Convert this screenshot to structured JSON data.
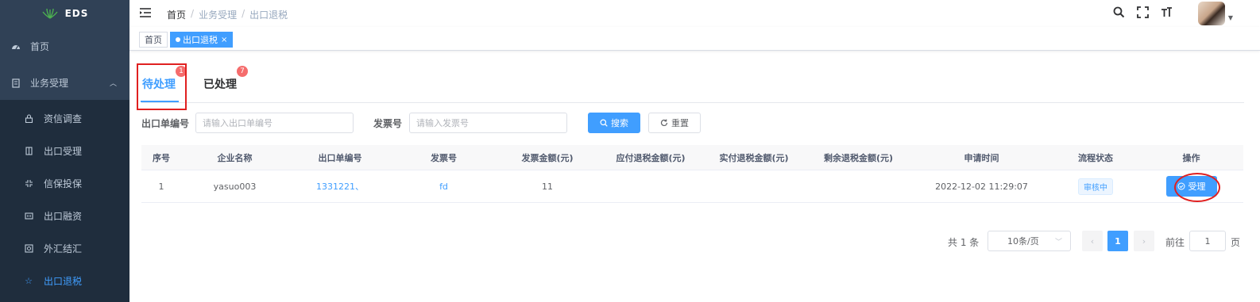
{
  "app": {
    "logo_text": "EDS"
  },
  "sidebar": {
    "items": [
      {
        "label": "首页",
        "icon": "dashboard-icon"
      },
      {
        "label": "业务受理",
        "icon": "business-icon",
        "expanded": true
      },
      {
        "label": "资信调查",
        "icon": "lock-icon"
      },
      {
        "label": "出口受理",
        "icon": "door-icon"
      },
      {
        "label": "信保投保",
        "icon": "shrink-icon"
      },
      {
        "label": "出口融资",
        "icon": "finance-icon"
      },
      {
        "label": "外汇结汇",
        "icon": "exchange-icon"
      },
      {
        "label": "出口退税",
        "icon": "star-icon",
        "active": true
      }
    ]
  },
  "header": {
    "breadcrumb": [
      "首页",
      "业务受理",
      "出口退税"
    ],
    "separator": "/"
  },
  "tags": [
    {
      "label": "首页",
      "active": false
    },
    {
      "label": "出口退税",
      "active": true,
      "close": "×"
    }
  ],
  "tabs": [
    {
      "label": "待处理",
      "badge": "1",
      "active": true
    },
    {
      "label": "已处理",
      "badge": "7",
      "active": false
    }
  ],
  "search": {
    "export_no_label": "出口单编号",
    "export_no_placeholder": "请输入出口单编号",
    "invoice_label": "发票号",
    "invoice_placeholder": "请输入发票号",
    "search_btn": "搜索",
    "reset_btn": "重置"
  },
  "table": {
    "columns": [
      "序号",
      "企业名称",
      "出口单编号",
      "发票号",
      "发票金额(元)",
      "应付退税金额(元)",
      "实付退税金额(元)",
      "剩余退税金额(元)",
      "申请时间",
      "流程状态",
      "操作"
    ],
    "rows": [
      {
        "index": "1",
        "company": "yasuo003",
        "export_no": "1331221、",
        "invoice_no": "fd",
        "invoice_amount": "11",
        "payable": "",
        "paid": "",
        "remaining": "",
        "apply_time": "2022-12-02 11:29:07",
        "status": "审核中",
        "action": "受理"
      }
    ]
  },
  "pagination": {
    "total": "共 1 条",
    "page_size": "10条/页",
    "current": "1",
    "goto_label": "前往",
    "goto_value": "1",
    "page_suffix": "页"
  },
  "colors": {
    "primary": "#409eff",
    "sidebar_bg": "#304156",
    "badge": "#f56c6c",
    "highlight": "#e02020"
  }
}
